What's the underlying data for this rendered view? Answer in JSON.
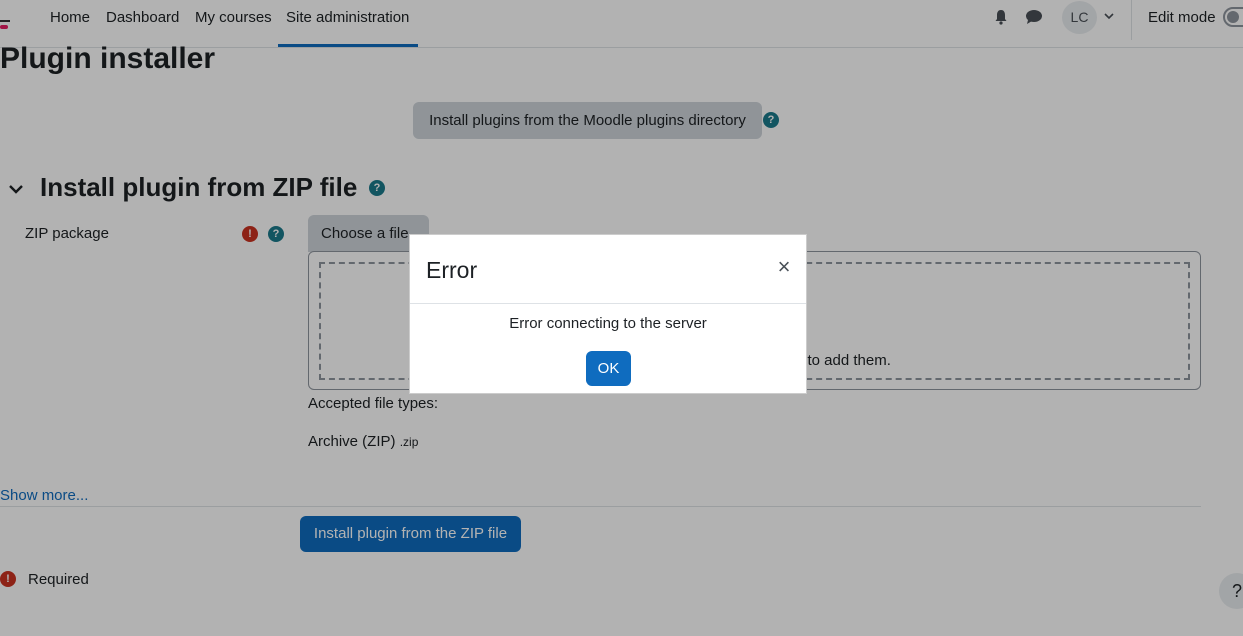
{
  "nav": {
    "items": [
      {
        "label": "Home"
      },
      {
        "label": "Dashboard"
      },
      {
        "label": "My courses"
      },
      {
        "label": "Site administration"
      }
    ],
    "avatar_initials": "LC",
    "edit_mode_label": "Edit mode",
    "active_item": "Site administration"
  },
  "page": {
    "title": "Plugin installer",
    "directory_button": "Install plugins from the Moodle plugins directory",
    "section_title": "Install plugin from ZIP file",
    "zip_label": "ZIP package",
    "choose_file_button": "Choose a file...",
    "drop_hint_partial": "re to add them.",
    "accepted_label": "Accepted file types:",
    "archive_type": "Archive (ZIP)",
    "archive_ext": ".zip",
    "show_more": "Show more...",
    "install_button": "Install plugin from the ZIP file",
    "required_label": "Required",
    "help_float": "?"
  },
  "modal": {
    "title": "Error",
    "close_glyph": "×",
    "message": "Error connecting to the server",
    "ok_button": "OK"
  },
  "colors": {
    "primary": "#0f6cbf",
    "danger": "#ca3120",
    "help": "#1b7a8c"
  }
}
